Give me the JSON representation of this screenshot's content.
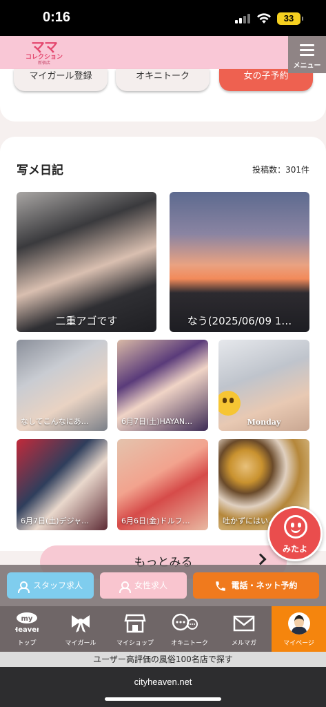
{
  "status": {
    "time": "0:16",
    "battery": "33"
  },
  "header": {
    "logo_main": "ママ",
    "logo_sub": "コレクション",
    "logo_tiny": "新宿店",
    "menu_label": "メニュー"
  },
  "quick_buttons": [
    "マイガール登録",
    "オキニトーク",
    "女の子予約"
  ],
  "diary": {
    "title": "写メ日記",
    "count": "投稿数：301件",
    "posts": [
      "二重アゴです",
      "なう(2025/06/09 1…",
      "なしてこんなにあ…",
      "6月7日(土)HAYAN…",
      "Monday",
      "6月7日(土)デジャ…",
      "6月6日(金)ドルフ…",
      "吐かずにはい…"
    ],
    "more_label": "もっとみる"
  },
  "mitayo_label": "みたよ",
  "actions": {
    "staff": "スタッフ求人",
    "female": "女性求人",
    "reserve": "電話・ネット予約"
  },
  "tabs": {
    "top_logo": "myHeaven",
    "top": "トップ",
    "mygirl": "マイガール",
    "myshop": "マイショップ",
    "okini": "オキニトーク",
    "melmaga": "メルマガ",
    "mypage": "マイページ"
  },
  "tagline": "ユーザー高評価の風俗100名店で探す",
  "url": "cityheaven.net",
  "colors": {
    "header_pink": "#f9c7d6",
    "reserve_orange": "#f07a1d",
    "mitayo_red": "#ea4d4d",
    "active_tab": "#f5850d"
  }
}
